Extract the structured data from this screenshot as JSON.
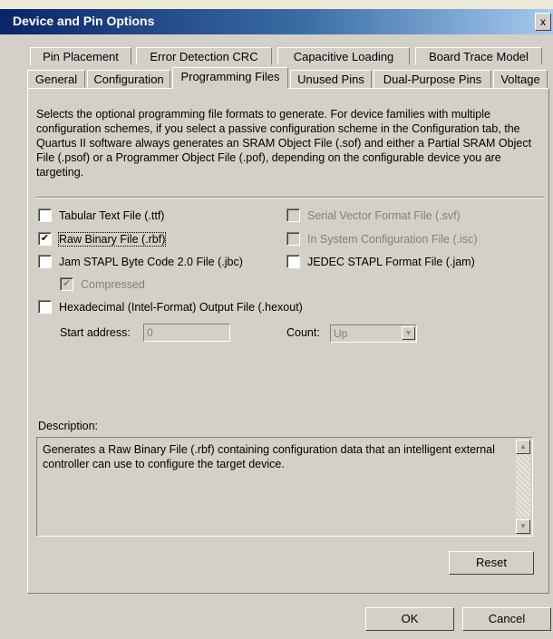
{
  "window": {
    "title": "Device and Pin Options",
    "close_glyph": "x"
  },
  "tabs": {
    "row1": [
      "Pin Placement",
      "Error Detection CRC",
      "Capacitive Loading",
      "Board Trace Model"
    ],
    "row2": [
      "General",
      "Configuration",
      "Programming Files",
      "Unused Pins",
      "Dual-Purpose Pins",
      "Voltage"
    ],
    "active": "Programming Files"
  },
  "intro": "Selects the optional programming file formats to generate. For device families with multiple configuration schemes, if you select a passive configuration scheme in the Configuration tab, the Quartus II software always generates an SRAM Object File (.sof) and either a Partial SRAM Object File (.psof) or a Programmer Object File (.pof), depending on the configurable device you are targeting.",
  "options": {
    "ttf": {
      "label": "Tabular Text File (.ttf)",
      "checked": false,
      "enabled": true
    },
    "rbf": {
      "label": "Raw Binary File (.rbf)",
      "checked": true,
      "enabled": true
    },
    "jbc": {
      "label": "Jam STAPL Byte Code 2.0 File (.jbc)",
      "checked": false,
      "enabled": true
    },
    "compressed": {
      "label": "Compressed",
      "checked": true,
      "enabled": false
    },
    "hexout": {
      "label": "Hexadecimal (Intel-Format) Output File (.hexout)",
      "checked": false,
      "enabled": true
    },
    "svf": {
      "label": "Serial Vector Format File (.svf)",
      "checked": false,
      "enabled": false
    },
    "isc": {
      "label": "In System Configuration File (.isc)",
      "checked": false,
      "enabled": false
    },
    "jam": {
      "label": "JEDEC STAPL Format File (.jam)",
      "checked": false,
      "enabled": true
    }
  },
  "hex": {
    "start_address_label": "Start address:",
    "start_address_value": "0",
    "count_label": "Count:",
    "count_value": "Up"
  },
  "description": {
    "label": "Description:",
    "text": "Generates a Raw Binary File (.rbf) containing configuration data that an intelligent external controller can use to configure the target device."
  },
  "buttons": {
    "reset": "Reset",
    "ok": "OK",
    "cancel": "Cancel"
  }
}
